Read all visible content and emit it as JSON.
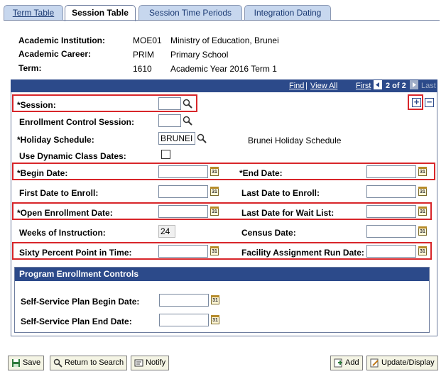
{
  "tabs": [
    {
      "label": "Term Table"
    },
    {
      "label": "Session Table"
    },
    {
      "label": "Session Time Periods"
    },
    {
      "label": "Integration Dating"
    }
  ],
  "header": {
    "institution_label": "Academic Institution:",
    "institution_code": "MOE01",
    "institution_name": "Ministry of Education, Brunei",
    "career_label": "Academic Career:",
    "career_code": "PRIM",
    "career_name": "Primary School",
    "term_label": "Term:",
    "term_code": "1610",
    "term_name": "Academic Year 2016 Term 1"
  },
  "nav": {
    "find": "Find",
    "separator": "|",
    "view_all": "View All",
    "first": "First",
    "position": "2 of 2",
    "last": "Last"
  },
  "fields": {
    "session_label": "*Session:",
    "session_value": "",
    "enrollment_control_label": "Enrollment Control Session:",
    "enrollment_control_value": "",
    "holiday_label": "*Holiday Schedule:",
    "holiday_value": "BRUNEI",
    "holiday_desc": "Brunei Holiday Schedule",
    "dynamic_label": "Use Dynamic Class Dates:",
    "begin_label": "*Begin Date:",
    "end_label": "*End Date:",
    "first_enroll_label": "First Date to Enroll:",
    "last_enroll_label": "Last Date to Enroll:",
    "open_enroll_label": "*Open Enrollment Date:",
    "last_waitlist_label": "Last Date for Wait List:",
    "weeks_label": "Weeks of Instruction:",
    "weeks_value": "24",
    "census_label": "Census Date:",
    "sixty_label": "Sixty Percent Point in Time:",
    "facility_label": "Facility Assignment Run Date:"
  },
  "group": {
    "title": "Program Enrollment Controls",
    "ss_begin_label": "Self-Service Plan Begin Date:",
    "ss_end_label": "Self-Service Plan End Date:"
  },
  "buttons": {
    "save": "Save",
    "return": "Return to Search",
    "notify": "Notify",
    "add": "Add",
    "update": "Update/Display"
  },
  "calendar_glyph": "31",
  "icons": {
    "add_row": "+",
    "delete_row": "−"
  },
  "colors": {
    "nav_bar": "#2c4a8a",
    "highlight": "#d8262a",
    "tab_inactive": "#c7d7ee"
  }
}
